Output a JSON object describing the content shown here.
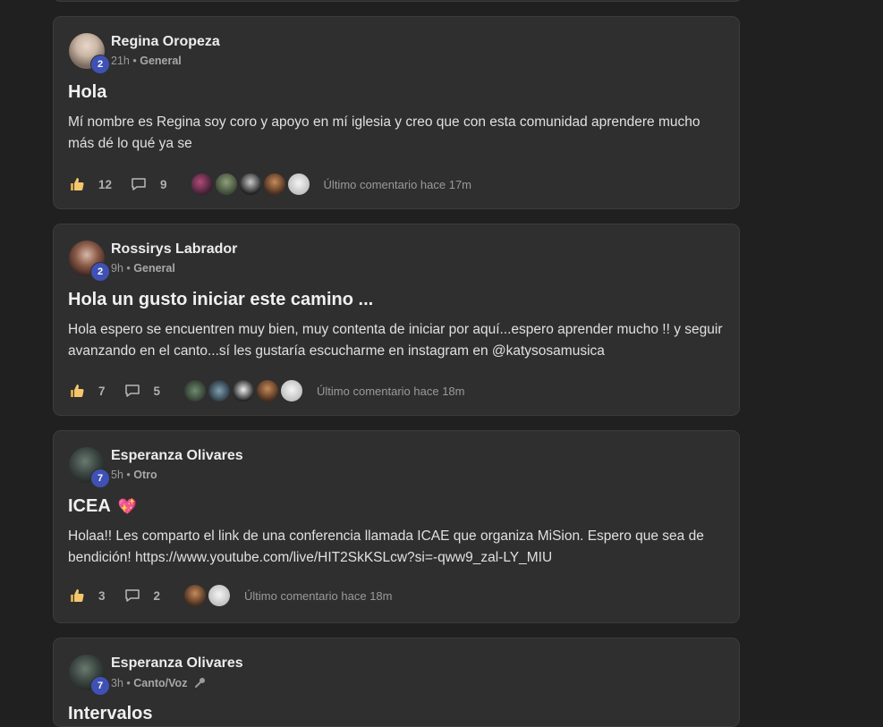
{
  "posts": [
    {
      "author": "Regina Oropeza",
      "level": "2",
      "time": "21h",
      "separator": "•",
      "category": "General",
      "title": "Hola",
      "title_emoji": "",
      "body": "Mí nombre es Regina soy coro y apoyo en mí iglesia y creo que con esta comunidad aprendere mucho más dé lo qué ya se",
      "likes": "12",
      "comments": "9",
      "last_comment": "Último comentario hace 17m"
    },
    {
      "author": "Rossirys Labrador",
      "level": "2",
      "time": "9h",
      "separator": "•",
      "category": "General",
      "title": "Hola un gusto iniciar este camino ...",
      "title_emoji": "",
      "body": "Hola espero se encuentren muy bien, muy contenta de iniciar por aquí...espero aprender mucho !! y seguir avanzando en el canto...sí les gustaría escucharme en instagram en @katysosamusica",
      "likes": "7",
      "comments": "5",
      "last_comment": "Último comentario hace 18m"
    },
    {
      "author": "Esperanza Olivares",
      "level": "7",
      "time": "5h",
      "separator": "•",
      "category": "Otro",
      "title": "ICEA",
      "title_emoji": "💖",
      "body": "Holaa!! Les comparto el link de una conferencia llamada ICAE que organiza MiSion. Espero que sea de bendición! https://www.youtube.com/live/HIT2SkKSLcw?si=-qww9_zal-LY_MIU",
      "likes": "3",
      "comments": "2",
      "last_comment": "Último comentario hace 18m"
    },
    {
      "author": "Esperanza Olivares",
      "level": "7",
      "time": "3h",
      "separator": "•",
      "category": "Canto/Voz",
      "category_icon": "microphone-icon",
      "title": "Intervalos"
    }
  ],
  "colors": {
    "background": "#202020",
    "card": "#2f2f2f",
    "level_badge": "#3f51b5",
    "like_icon": "#f2c76e"
  }
}
